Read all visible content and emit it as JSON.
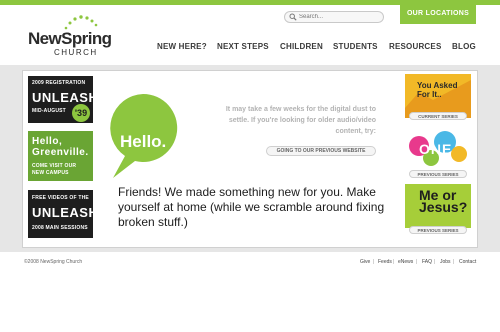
{
  "header": {
    "logo_word": "NewSpring",
    "logo_sub": "CHURCH",
    "search_placeholder": "Search...",
    "locations_label": "OUR LOCATIONS",
    "nav": [
      "NEW HERE?",
      "NEXT STEPS",
      "CHILDREN",
      "STUDENTS",
      "RESOURCES",
      "BLOG"
    ]
  },
  "promos": {
    "p1_top": "2009 REGISTRATION",
    "p1_big": "UNLEASH",
    "p1_bottom": "MID-AUGUST",
    "p1_badge": "'39",
    "p2_big": "Hello, Greenville.",
    "p2_small": "COME VISIT OUR NEW CAMPUS",
    "p3_top": "FREE VIDEOS OF THE",
    "p3_big": "UNLEASH",
    "p3_bottom": "2008 MAIN SESSIONS"
  },
  "main": {
    "hello": "Hello.",
    "dust": "It may take a few weeks for the digital dust to settle. If you're looking for older audio/video content, try:",
    "prev_site": "GOING TO OUR PREVIOUS WEBSITE",
    "friends": "Friends! We made something new for you. Make yourself at home (while we scramble around fixing broken stuff.)"
  },
  "series": {
    "s1_title": "You Asked For It..",
    "s1_btn": "CURRENT SERIES",
    "s2_title": "ONE",
    "s2_btn": "PREVIOUS SERIES",
    "s3_title": "Me or Jesus?",
    "s3_btn": "PREVIOUS SERIES"
  },
  "footer": {
    "copyright": "©2008 NewSpring Church",
    "links": [
      "Give",
      "Feeds",
      "eNews",
      "FAQ",
      "Jobs",
      "Contact"
    ]
  },
  "colors": {
    "brand_green": "#8dc63f",
    "dark": "#1e1e1e",
    "yellow": "#f2b927"
  }
}
